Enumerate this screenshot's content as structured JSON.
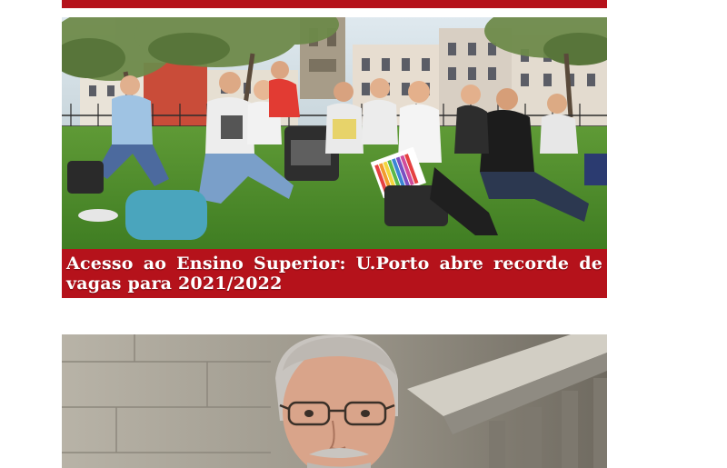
{
  "news": {
    "items": [
      {
        "title": "Acesso ao Ensino Superior: U.Porto abre recorde de vagas para 2021/2022",
        "photo": "students-sitting-on-grass-photo"
      },
      {
        "title": "",
        "photo": "professor-portrait-photo"
      }
    ]
  },
  "colors": {
    "caption_background": "#b5121b",
    "caption_text": "#ffffff",
    "page_background": "#ffffff"
  }
}
